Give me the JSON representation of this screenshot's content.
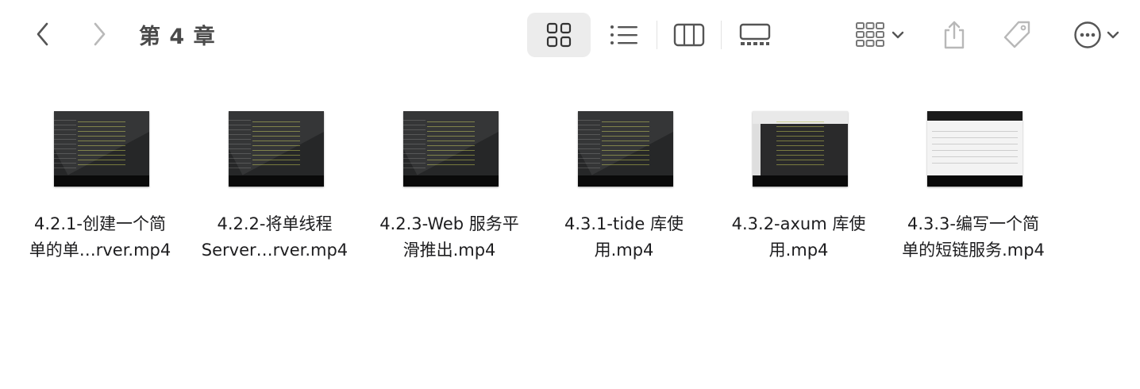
{
  "toolbar": {
    "title": "第 4 章",
    "back_icon": "chevron-left-icon",
    "forward_icon": "chevron-right-icon",
    "views": [
      {
        "name": "icon-view",
        "icon": "grid-icon",
        "selected": true
      },
      {
        "name": "list-view",
        "icon": "list-icon",
        "selected": false
      },
      {
        "name": "column-view",
        "icon": "columns-icon",
        "selected": false
      },
      {
        "name": "gallery-view",
        "icon": "gallery-icon",
        "selected": false
      }
    ],
    "group_icon": "group-icon",
    "share_icon": "share-icon",
    "tag_icon": "tag-icon",
    "more_icon": "ellipsis-icon"
  },
  "files": [
    {
      "line1": "4.2.1-创建一个简",
      "line2": "单的单…rver.mp4",
      "thumb": "dark"
    },
    {
      "line1": "4.2.2-将单线程",
      "line2": "Server…rver.mp4",
      "thumb": "dark"
    },
    {
      "line1": "4.2.3-Web 服务平",
      "line2": "滑推出.mp4",
      "thumb": "dark"
    },
    {
      "line1": "4.3.1-tide 库使",
      "line2": "用.mp4",
      "thumb": "dark"
    },
    {
      "line1": "4.3.2-axum 库使",
      "line2": "用.mp4",
      "thumb": "mixed"
    },
    {
      "line1": "4.3.3-编写一个简",
      "line2": "单的短链服务.mp4",
      "thumb": "light"
    }
  ],
  "colors": {
    "selected_view_bg": "#ececec",
    "icon_gray": "#6e6e6e",
    "icon_light": "#b8b8b8",
    "text": "#1d1d1f"
  }
}
